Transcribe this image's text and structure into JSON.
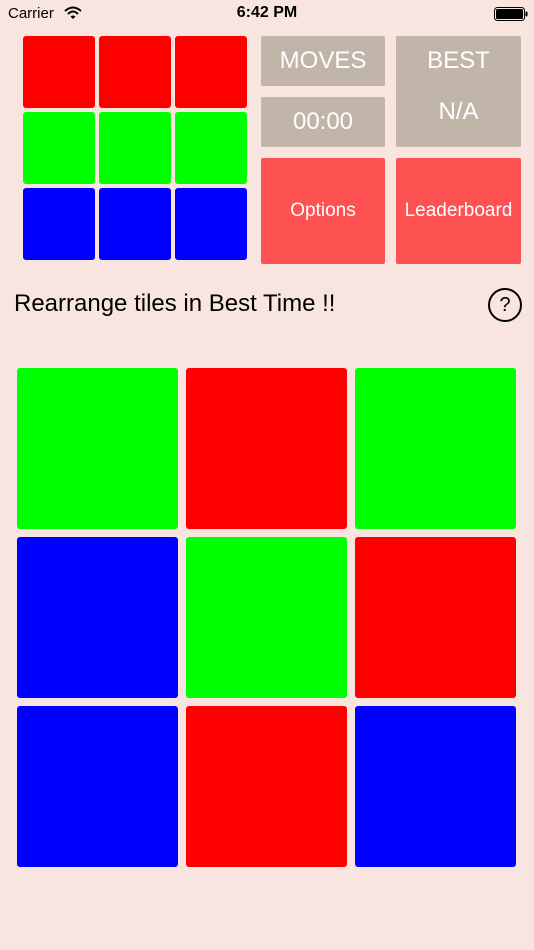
{
  "status_bar": {
    "carrier": "Carrier",
    "time": "6:42 PM",
    "wifi_icon": "wifi-icon",
    "battery_icon": "battery-icon"
  },
  "colors": {
    "background": "#f9e5df",
    "red": "#ff0000",
    "green": "#00ff00",
    "blue": "#0000ff",
    "info_box": "#c1b4a8",
    "button": "#fe5152"
  },
  "target_pattern": [
    [
      "red",
      "red",
      "red"
    ],
    [
      "green",
      "green",
      "green"
    ],
    [
      "blue",
      "blue",
      "blue"
    ]
  ],
  "stats": {
    "moves_label": "MOVES",
    "timer": "00:00",
    "best_label": "BEST",
    "best_value": "N/A"
  },
  "buttons": {
    "options": "Options",
    "leaderboard": "Leaderboard",
    "help": "?"
  },
  "instruction": "Rearrange tiles in Best Time !!",
  "board": [
    [
      "green",
      "red",
      "green"
    ],
    [
      "blue",
      "green",
      "red"
    ],
    [
      "blue",
      "red",
      "blue"
    ]
  ]
}
